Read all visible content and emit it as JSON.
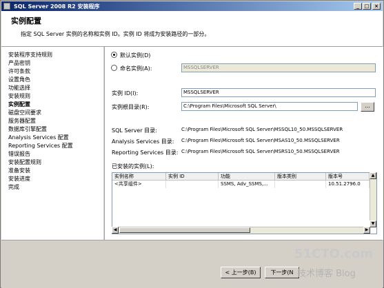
{
  "window": {
    "title": "SQL Server 2008 R2 安装程序"
  },
  "header": {
    "title": "实例配置",
    "description": "指定 SQL Server 实例的名称和实例 ID。实例 ID 将成为安装路径的一部分。"
  },
  "nav": {
    "items": [
      {
        "label": "安装程序支持规则"
      },
      {
        "label": "产品密钥"
      },
      {
        "label": "许可条款"
      },
      {
        "label": "设置角色"
      },
      {
        "label": "功能选择"
      },
      {
        "label": "安装规则"
      },
      {
        "label": "实例配置"
      },
      {
        "label": "磁盘空间要求"
      },
      {
        "label": "服务器配置"
      },
      {
        "label": "数据库引擎配置"
      },
      {
        "label": "Analysis Services 配置"
      },
      {
        "label": "Reporting Services 配置"
      },
      {
        "label": "错误报告"
      },
      {
        "label": "安装配置规则"
      },
      {
        "label": "准备安装"
      },
      {
        "label": "安装进度"
      },
      {
        "label": "完成"
      }
    ]
  },
  "instance": {
    "default_label": "默认实例(D)",
    "named_label": "命名实例(A):",
    "named_value": "MSSQLSERVER",
    "id_label": "实例 ID(I):",
    "id_value": "MSSQLSERVER",
    "root_label": "实例根目录(R):",
    "root_value": "C:\\Program Files\\Microsoft SQL Server\\",
    "browse_label": "..."
  },
  "dirs": [
    {
      "label": "SQL Server 目录:",
      "value": "C:\\Program Files\\Microsoft SQL Server\\MSSQL10_50.MSSQLSERVER"
    },
    {
      "label": "Analysis Services 目录:",
      "value": "C:\\Program Files\\Microsoft SQL Server\\MSAS10_50.MSSQLSERVER"
    },
    {
      "label": "Reporting Services 目录:",
      "value": "C:\\Program Files\\Microsoft SQL Server\\MSRS10_50.MSSQLSERVER"
    }
  ],
  "installed": {
    "label": "已安装的实例(L):",
    "columns": [
      "实例名称",
      "实例 ID",
      "功能",
      "版本类别",
      "版本号"
    ],
    "rows": [
      [
        "<共享组件>",
        "",
        "SSMS, Adv_SSMS,...",
        "",
        "10.51.2796.0"
      ]
    ]
  },
  "footer": {
    "back_label": "< 上一步(B)",
    "next_label": "下一步(N"
  },
  "watermark": {
    "line1": "51CTO.com",
    "line2": "技术博客 Blog"
  }
}
